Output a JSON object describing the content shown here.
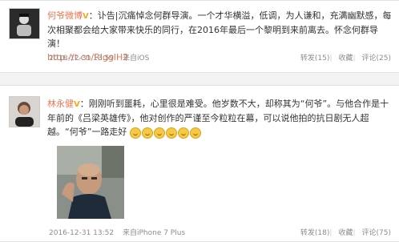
{
  "posts": [
    {
      "author": "何爷微博",
      "content": "：讣告|沉痛悼念何群导演。一个才华横溢，低调，为人谦和，充满幽默感，每次相聚都会给大家带来快乐的同行，在2016年最后一个黎明到来前离去。怀念何群导演！",
      "link": "http://t.cn/RlgglH2",
      "time": "2016-12-31 13:59",
      "source": "来自iOS",
      "repost": "转发(15)",
      "favorite": "收藏",
      "comment": "评论(25)"
    },
    {
      "author": "林永健",
      "content": "：刚刚听到噩耗，心里很是难受。他岁数不大，却称其为“何爷”。与他合作是十年前的《吕梁英雄传》，他对创作的严谨至今粒粒在幕，可以说他拍的抗日剧无人超越。“何爷”一路走好",
      "time": "2016-12-31 13:52",
      "source": "来自iPhone 7 Plus",
      "repost": "转发(18)",
      "favorite": "收藏",
      "comment": "评论(75)"
    }
  ],
  "icons": {
    "badge": "v-badge-icon",
    "emoji": "crying-emoji-icon"
  },
  "colors": {
    "author": "#eb7350",
    "badge": "#f5a623",
    "meta": "#8c8c8c"
  }
}
